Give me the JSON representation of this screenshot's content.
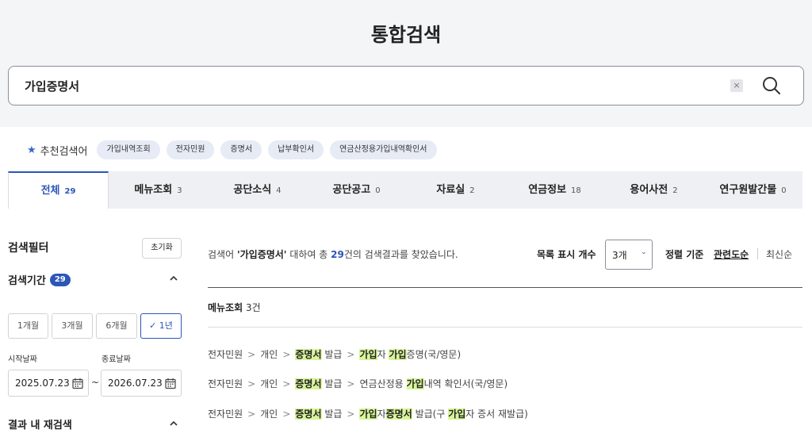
{
  "page_title": "통합검색",
  "search": {
    "value": "가입증명서",
    "clear_label": "×"
  },
  "recommended": {
    "label": "추천검색어",
    "chips": [
      "가입내역조회",
      "전자민원",
      "증명서",
      "납부확인서",
      "연금산정용가입내역확인서"
    ]
  },
  "tabs": [
    {
      "label": "전체",
      "count": "29"
    },
    {
      "label": "메뉴조회",
      "count": "3"
    },
    {
      "label": "공단소식",
      "count": "4"
    },
    {
      "label": "공단공고",
      "count": "0"
    },
    {
      "label": "자료실",
      "count": "2"
    },
    {
      "label": "연금정보",
      "count": "18"
    },
    {
      "label": "용어사전",
      "count": "2"
    },
    {
      "label": "연구원발간물",
      "count": "0"
    }
  ],
  "filter": {
    "title": "검색필터",
    "reset_label": "초기화",
    "period_title": "검색기간",
    "period_count": "29",
    "periods": [
      "1개월",
      "3개월",
      "6개월",
      "1년"
    ],
    "selected_period": "1년",
    "start_label": "시작날짜",
    "end_label": "종료날짜",
    "start_date": "2025.07.23",
    "end_date": "2026.07.23",
    "tilde": "~",
    "refine_title": "결과 내 재검색"
  },
  "results": {
    "summary_pre": "검색어 ",
    "summary_query": "'가입증명서'",
    "summary_mid": " 대하여 총 ",
    "summary_count": "29",
    "summary_post": "건의 검색결과를 찾았습니다.",
    "list_count_label": "목록 표시 개수",
    "list_count_value": "3개",
    "sort_label": "정렬 기준",
    "sort_active": "관련도순",
    "sort_other": "최신순",
    "section_name": "메뉴조회",
    "section_count": "3건",
    "crumb_1": "전자민원",
    "crumb_2": "개인",
    "row1": {
      "c3a": "증명서",
      "c3b": " 발급",
      "c4a": "가입",
      "c4b": "자 ",
      "c4c": "가입",
      "c4d": "증명(국/영문)"
    },
    "row2": {
      "c3a": "증명서",
      "c3b": " 발급",
      "c4a": "연금산정용 ",
      "c4b": "가입",
      "c4c": "내역 확인서(국/영문)"
    },
    "row3": {
      "c3a": "증명서",
      "c3b": " 발급",
      "c4a": "가입",
      "c4b": "자",
      "c4c": "증명서",
      "c4d": " 발급(구 ",
      "c4e": "가입",
      "c4f": "자 증서 재발급)"
    }
  }
}
